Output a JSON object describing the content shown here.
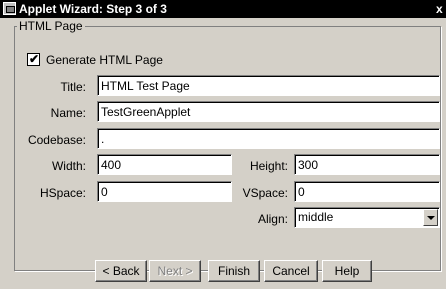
{
  "window": {
    "title": "Applet Wizard: Step 3 of 3",
    "close_label": "x"
  },
  "group": {
    "title": "HTML Page"
  },
  "generate": {
    "checked": true,
    "check_mark": "✔",
    "label": "Generate HTML Page"
  },
  "fields": {
    "title": {
      "label": "Title:",
      "value": "HTML Test Page"
    },
    "name": {
      "label": "Name:",
      "value": "TestGreenApplet"
    },
    "codebase": {
      "label": "Codebase:",
      "value": "."
    },
    "width": {
      "label": "Width:",
      "value": "400"
    },
    "height": {
      "label": "Height:",
      "value": "300"
    },
    "hspace": {
      "label": "HSpace:",
      "value": "0"
    },
    "vspace": {
      "label": "VSpace:",
      "value": "0"
    },
    "align": {
      "label": "Align:",
      "value": "middle"
    }
  },
  "buttons": {
    "back": "< Back",
    "next": "Next >",
    "finish": "Finish",
    "cancel": "Cancel",
    "help": "Help"
  },
  "colors": {
    "background": "#d4d0c8",
    "titlebar": "#000000",
    "disabled_text": "#808080"
  },
  "icons": {
    "app": "applet-window-icon",
    "close": "close-icon",
    "dropdown": "dropdown-arrow-icon"
  }
}
